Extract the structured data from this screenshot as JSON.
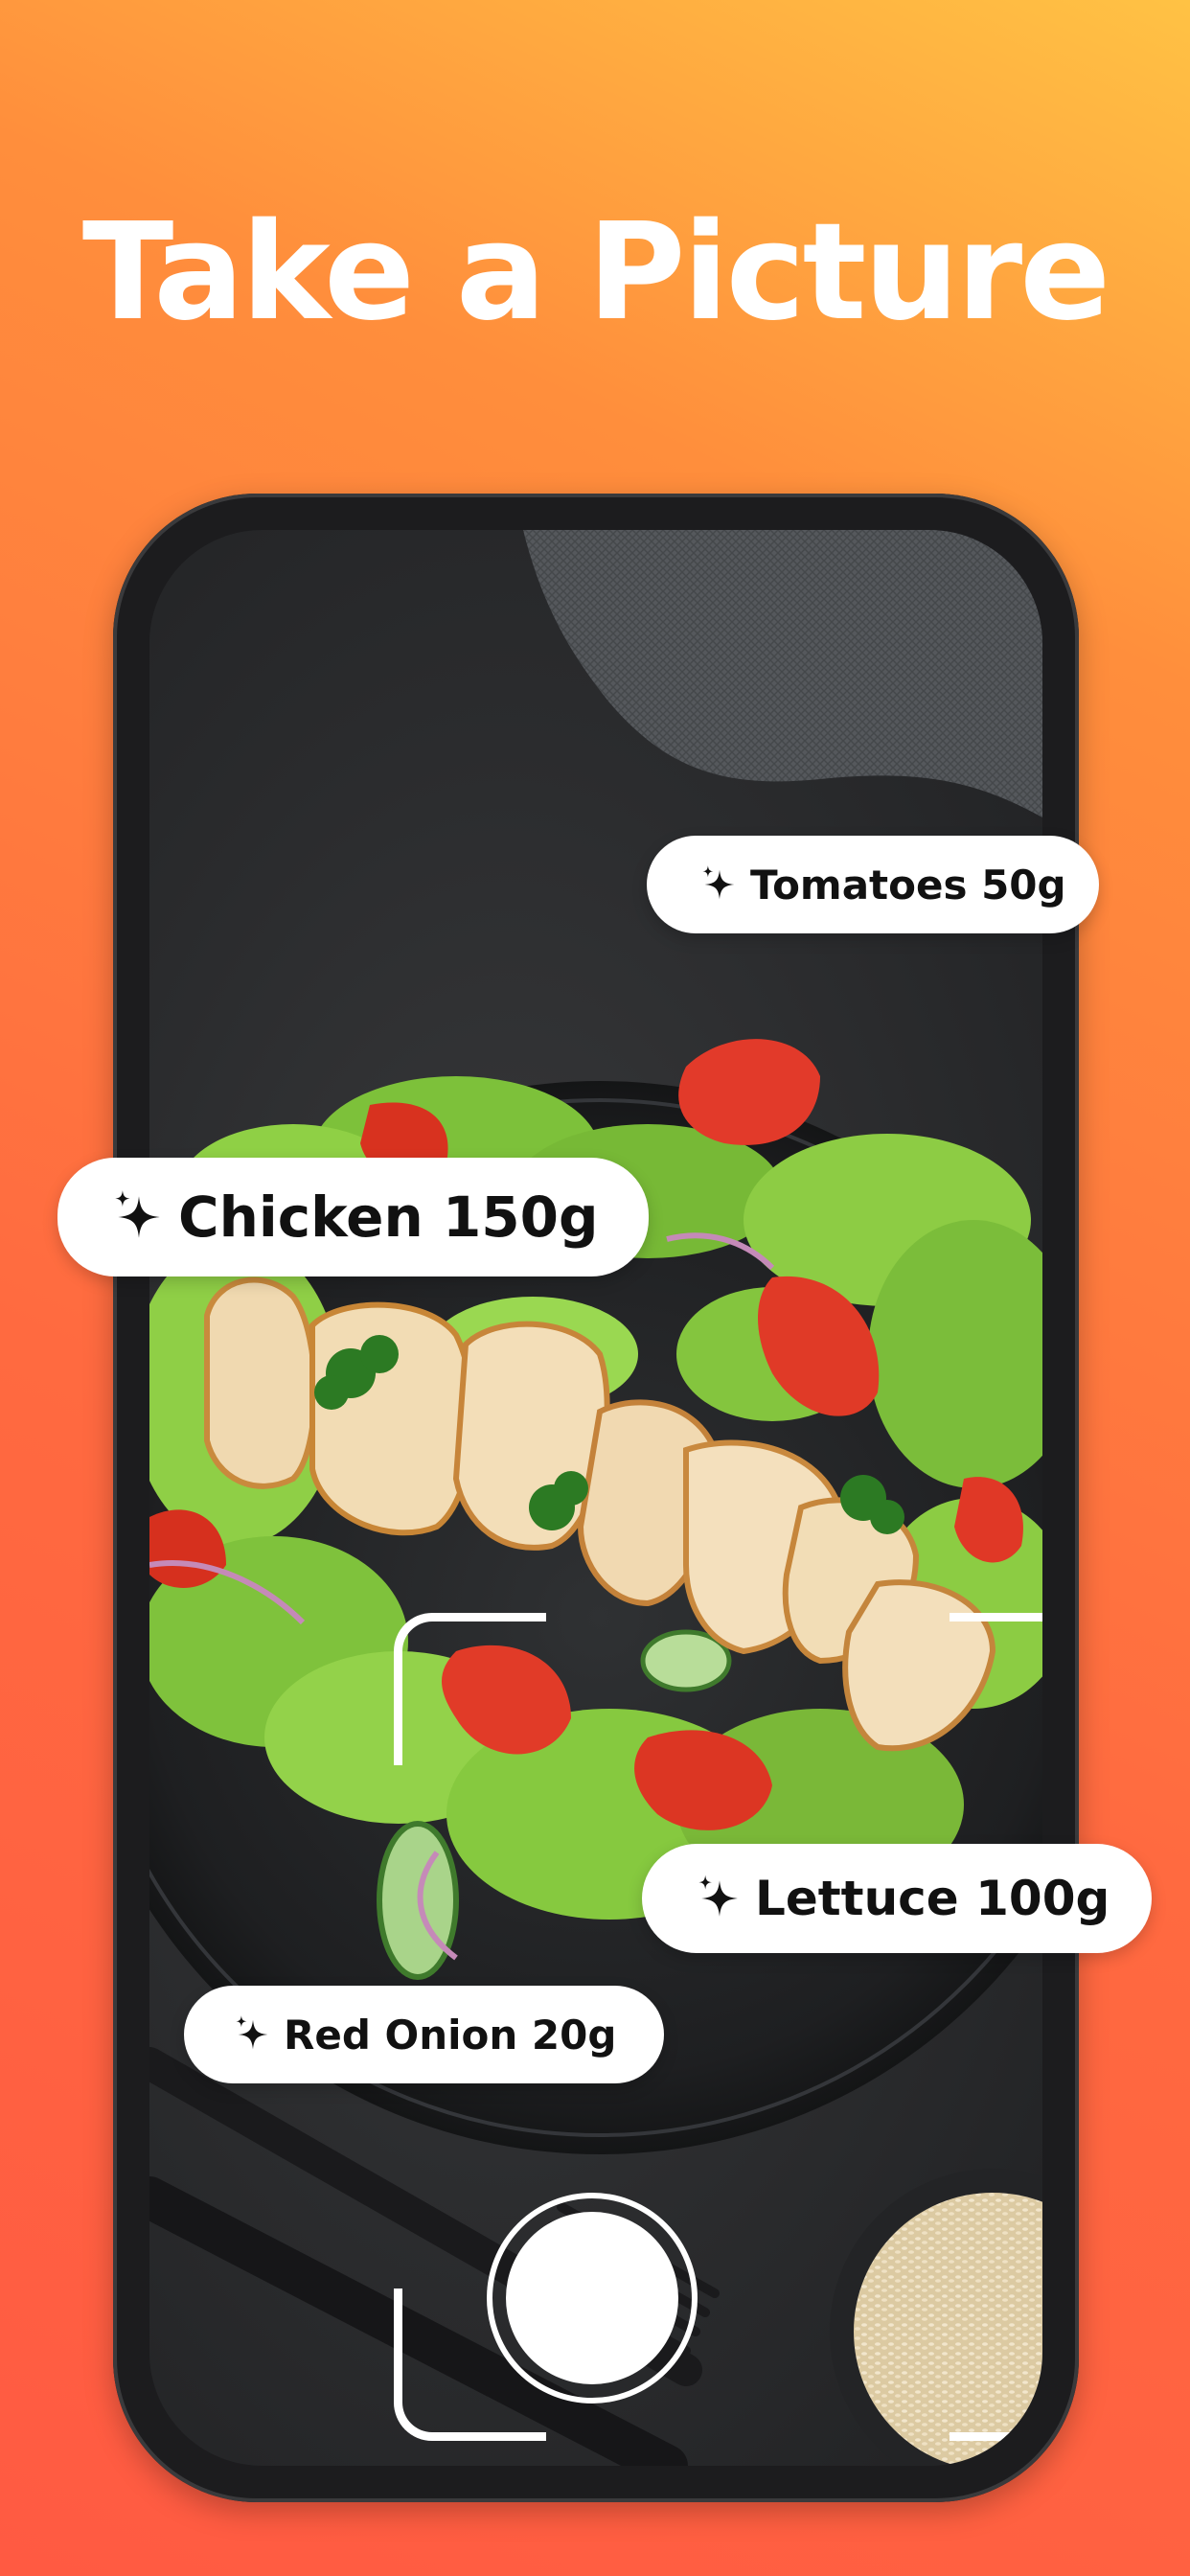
{
  "headline": "Take a Picture",
  "colors": {
    "gradient_top": "#FFC244",
    "gradient_bottom": "#FF5A42",
    "tag_background": "#FFFFFF",
    "tag_text": "#111111",
    "phone_frame": "#1C1C1E"
  },
  "detections": [
    {
      "label": "Tomatoes 50g",
      "icon": "sparkles-icon"
    },
    {
      "label": "Chicken 150g",
      "icon": "sparkles-icon"
    },
    {
      "label": "Lettuce 100g",
      "icon": "sparkles-icon"
    },
    {
      "label": "Red Onion 20g",
      "icon": "sparkles-icon"
    }
  ],
  "camera": {
    "shutter_icon": "shutter-button",
    "photo_subject": "salad-photo"
  }
}
